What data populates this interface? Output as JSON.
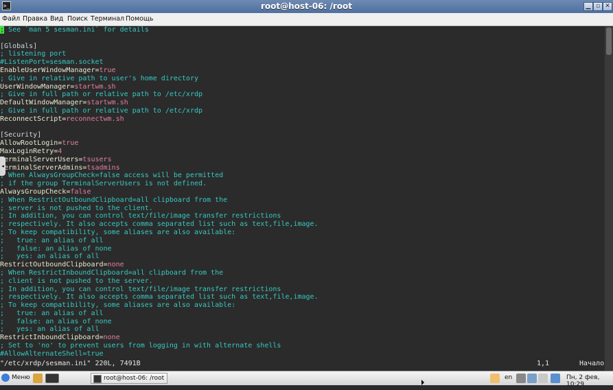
{
  "window": {
    "title": "root@host-06: /root",
    "icon": "terminal-icon"
  },
  "menubar": [
    "Файл",
    "Правка",
    "Вид",
    "Поиск",
    "Терминал",
    "Помощь"
  ],
  "terminal": {
    "lines": [
      [
        {
          "t": "c",
          "s": ";"
        },
        {
          "t": "comment",
          "s": " See `man 5 sesman.ini` for details"
        }
      ],
      [],
      [
        {
          "t": "section",
          "s": "[Globals]"
        }
      ],
      [
        {
          "t": "comment",
          "s": "; listening port"
        }
      ],
      [
        {
          "t": "comment",
          "s": "#ListenPort=sesman.socket"
        }
      ],
      [
        {
          "t": "key",
          "s": "EnableUserWindowManager="
        },
        {
          "t": "val",
          "s": "true"
        }
      ],
      [
        {
          "t": "comment",
          "s": "; Give in relative path to user's home directory"
        }
      ],
      [
        {
          "t": "key",
          "s": "UserWindowManager="
        },
        {
          "t": "val",
          "s": "startwm.sh"
        }
      ],
      [
        {
          "t": "comment",
          "s": "; Give in full path or relative path to /etc/xrdp"
        }
      ],
      [
        {
          "t": "key",
          "s": "DefaultWindowManager="
        },
        {
          "t": "val",
          "s": "startwm.sh"
        }
      ],
      [
        {
          "t": "comment",
          "s": "; Give in full path or relative path to /etc/xrdp"
        }
      ],
      [
        {
          "t": "key",
          "s": "ReconnectScript="
        },
        {
          "t": "val",
          "s": "reconnectwm.sh"
        }
      ],
      [],
      [
        {
          "t": "section",
          "s": "[Security]"
        }
      ],
      [
        {
          "t": "key",
          "s": "AllowRootLogin="
        },
        {
          "t": "val",
          "s": "true"
        }
      ],
      [
        {
          "t": "key",
          "s": "MaxLoginRetry="
        },
        {
          "t": "val",
          "s": "4"
        }
      ],
      [
        {
          "t": "key",
          "s": "TerminalServerUsers="
        },
        {
          "t": "val",
          "s": "tsusers"
        }
      ],
      [
        {
          "t": "key",
          "s": "TerminalServerAdmins="
        },
        {
          "t": "val",
          "s": "tsadmins"
        }
      ],
      [
        {
          "t": "comment",
          "s": "; When AlwaysGroupCheck=false access will be permitted"
        }
      ],
      [
        {
          "t": "comment",
          "s": "; if the group TerminalServerUsers is not defined."
        }
      ],
      [
        {
          "t": "key",
          "s": "AlwaysGroupCheck="
        },
        {
          "t": "val",
          "s": "false"
        }
      ],
      [
        {
          "t": "comment",
          "s": "; When RestrictOutboundClipboard=all clipboard from the"
        }
      ],
      [
        {
          "t": "comment",
          "s": "; server is not pushed to the client."
        }
      ],
      [
        {
          "t": "comment",
          "s": "; In addition, you can control text/file/image transfer restrictions"
        }
      ],
      [
        {
          "t": "comment",
          "s": "; respectively. It also accepts comma separated list such as text,file,image."
        }
      ],
      [
        {
          "t": "comment",
          "s": "; To keep compatibility, some aliases are also available:"
        }
      ],
      [
        {
          "t": "comment",
          "s": ";   true: an alias of all"
        }
      ],
      [
        {
          "t": "comment",
          "s": ";   false: an alias of none"
        }
      ],
      [
        {
          "t": "comment",
          "s": ";   yes: an alias of all"
        }
      ],
      [
        {
          "t": "key",
          "s": "RestrictOutboundClipboard="
        },
        {
          "t": "val",
          "s": "none"
        }
      ],
      [
        {
          "t": "comment",
          "s": "; When RestrictInboundClipboard=all clipboard from the"
        }
      ],
      [
        {
          "t": "comment",
          "s": "; client is not pushed to the server."
        }
      ],
      [
        {
          "t": "comment",
          "s": "; In addition, you can control text/file/image transfer restrictions"
        }
      ],
      [
        {
          "t": "comment",
          "s": "; respectively. It also accepts comma separated list such as text,file,image."
        }
      ],
      [
        {
          "t": "comment",
          "s": "; To keep compatibility, some aliases are also available:"
        }
      ],
      [
        {
          "t": "comment",
          "s": ";   true: an alias of all"
        }
      ],
      [
        {
          "t": "comment",
          "s": ";   false: an alias of none"
        }
      ],
      [
        {
          "t": "comment",
          "s": ";   yes: an alias of all"
        }
      ],
      [
        {
          "t": "key",
          "s": "RestrictInboundClipboard="
        },
        {
          "t": "val",
          "s": "none"
        }
      ],
      [
        {
          "t": "comment",
          "s": "; Set to 'no' to prevent users from logging in with alternate shells"
        }
      ],
      [
        {
          "t": "comment",
          "s": "#AllowAlternateShell=true"
        }
      ]
    ],
    "status": {
      "file": "\"/etc/xrdp/sesman.ini\" 220L, 7491B",
      "position": "1,1",
      "scroll": "Начало"
    }
  },
  "taskbar": {
    "menu_label": "Меню",
    "task_label": "root@host-06: /root",
    "language": "en",
    "clock": "Пн,  2 фев, 10:29"
  },
  "colors": {
    "background": "#2b2b2b",
    "comment": "#36c9c2",
    "value": "#e47fa0",
    "cursor": "#3fe03f"
  }
}
